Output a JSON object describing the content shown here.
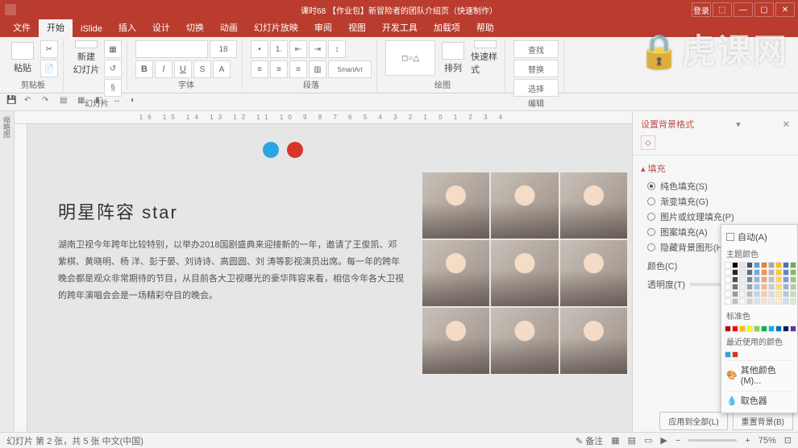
{
  "titlebar": {
    "title": "课时68 【作业包】新冒险者的团队介绍页（快速制作）",
    "login": "登录"
  },
  "tabs": [
    "文件",
    "开始",
    "iSlide",
    "插入",
    "设计",
    "切换",
    "动画",
    "幻灯片放映",
    "审阅",
    "视图",
    "开发工具",
    "加载项",
    "帮助"
  ],
  "active_tab": 1,
  "ribbon_groups": [
    "剪贴板",
    "幻灯片",
    "字体",
    "段落",
    "绘图",
    "编辑"
  ],
  "ribbon_items": {
    "paste": "粘贴",
    "newslide": "新建\n幻灯片",
    "find": "查找",
    "replace": "替换",
    "select": "选择",
    "arrange": "排列",
    "quickstyle": "快速样式"
  },
  "slide": {
    "heading": "明星阵容  star",
    "para": "湖南卫视今年跨年比较特别，以举办2018国剧盛典来迎接新的一年，邀请了王俊凯、邓紫棋、黄晓明、杨 洋、彭于晏、刘诗诗、高圆圆、刘 涛等影视演员出席。每一年的跨年晚会都是观众非常期待的节目，从目前各大卫视曝光的豪华阵容来看，相信今年各大卫视的跨年演唱会会是一场精彩夺目的晚会。"
  },
  "side": {
    "title": "设置背景格式",
    "section": "填充",
    "opts": [
      "纯色填充(S)",
      "渐变填充(G)",
      "图片或纹理填充(P)",
      "图案填充(A)",
      "隐藏背景图形(H)"
    ],
    "selected": 0,
    "color_label": "颜色(C)",
    "trans_label": "透明度(T)",
    "apply_all": "应用到全部(L)",
    "reset": "重置背景(B)"
  },
  "popup": {
    "auto": "自动(A)",
    "theme": "主题颜色",
    "standard": "标准色",
    "recent": "最近使用的颜色",
    "more": "其他颜色(M)...",
    "eyedrop": "取色器",
    "theme_colors": [
      "#ffffff",
      "#000000",
      "#e7e6e6",
      "#44546a",
      "#5b9bd5",
      "#ed7d31",
      "#a5a5a5",
      "#ffc000",
      "#4472c4",
      "#70ad47"
    ],
    "standard_colors": [
      "#c00000",
      "#ff0000",
      "#ffc000",
      "#ffff00",
      "#92d050",
      "#00b050",
      "#00b0f0",
      "#0070c0",
      "#002060",
      "#7030a0"
    ],
    "recent_colors": [
      "#29a7e1",
      "#d8352a"
    ]
  },
  "status": {
    "left": "幻灯片 第 2 张，共 5 张    中文(中国)",
    "notes": "备注",
    "zoom": "75%"
  },
  "ruler": "16 15 14 13 12 11 10 9 8 7 6 5 4 3 2 1 0 1 2 3 4"
}
